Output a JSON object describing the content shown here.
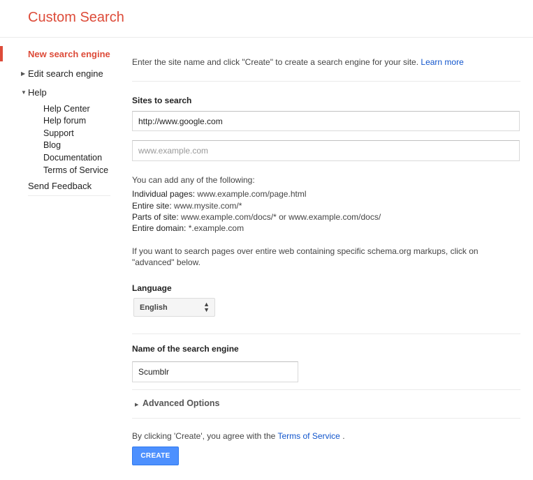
{
  "header": {
    "title": "Custom Search"
  },
  "sidebar": {
    "new_engine": "New search engine",
    "edit_engine": "Edit search engine",
    "help": "Help",
    "help_links": [
      "Help Center",
      "Help forum",
      "Support",
      "Blog",
      "Documentation",
      "Terms of Service"
    ],
    "feedback": "Send Feedback",
    "accent_color": "#dd4b39"
  },
  "intro": {
    "text": "Enter the site name and click \"Create\" to create a search engine for your site.",
    "learn_more": "Learn more"
  },
  "sites": {
    "label": "Sites to search",
    "site1_value": "http://www.google.com",
    "site2_placeholder": "www.example.com"
  },
  "hints": {
    "intro": "You can add any of the following:",
    "rows": [
      {
        "label": "Individual pages:",
        "example": "www.example.com/page.html"
      },
      {
        "label": "Entire site:",
        "example": "www.mysite.com/*"
      },
      {
        "label": "Parts of site:",
        "example": "www.example.com/docs/* or www.example.com/docs/"
      },
      {
        "label": "Entire domain:",
        "example": "*.example.com"
      }
    ],
    "schema_note": "If you want to search pages over entire web containing specific schema.org markups, click on \"advanced\" below."
  },
  "language": {
    "label": "Language",
    "selected": "English"
  },
  "name": {
    "label": "Name of the search engine",
    "value": "Scumblr"
  },
  "advanced": {
    "label": "Advanced Options"
  },
  "agreement": {
    "text": "By clicking 'Create', you agree with the",
    "link": "Terms of Service",
    "end": "."
  },
  "create": {
    "label": "CREATE",
    "color": "#4d90fe"
  }
}
